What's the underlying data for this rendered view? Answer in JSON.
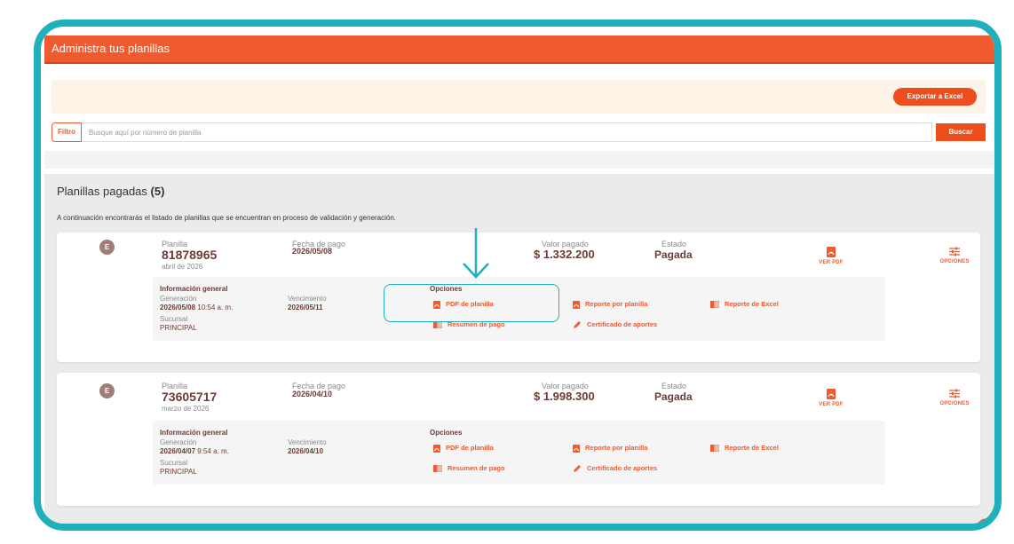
{
  "header": {
    "title": "Administra tus planillas"
  },
  "toolbar": {
    "export_label": "Exportar a Excel"
  },
  "search": {
    "filter_label": "Filtro",
    "placeholder": "Busque aquí por número de planilla",
    "button_label": "Buscar"
  },
  "list": {
    "title": "Planillas pagadas",
    "count": "(5)",
    "description": "A continuación encontrarás el listado de planillas que se encuentran en proceso de validación y generación."
  },
  "labels": {
    "planilla": "Planilla",
    "fecha_pago": "Fecha de pago",
    "valor_pagado": "Valor pagado",
    "estado": "Estado",
    "ver_pdf": "VER PDF",
    "opciones": "OPCIONES",
    "info_general": "Información general",
    "generacion": "Generación",
    "vencimiento": "Vencimiento",
    "sucursal": "Sucursal",
    "opciones_title": "Opciones"
  },
  "options": {
    "pdf": "PDF de planilla",
    "reporte_planilla": "Reporte por planilla",
    "reporte_excel": "Reporte de Excel",
    "resumen": "Resumen de pago",
    "certificado": "Certificado de aportes"
  },
  "cards": [
    {
      "avatar": "E",
      "number": "81878965",
      "period": "abril de 2026",
      "payment_date": "2026/05/08",
      "amount": "$ 1.332.200",
      "status": "Pagada",
      "generation_date": "2026/05/08",
      "generation_time": " 10:54 a. m.",
      "due_date": "2026/05/11",
      "branch": "PRINCIPAL"
    },
    {
      "avatar": "E",
      "number": "73605717",
      "period": "marzo de 2026",
      "payment_date": "2026/04/10",
      "amount": "$ 1.998.300",
      "status": "Pagada",
      "generation_date": "2026/04/07",
      "generation_time": " 9:54 a. m.",
      "due_date": "2026/04/10",
      "branch": "PRINCIPAL"
    }
  ],
  "colors": {
    "accent": "#ef5a2e",
    "highlight": "#1fb0bb",
    "text_dark": "#6d3b35"
  },
  "icons": [
    "pdf-icon",
    "sliders-icon",
    "excel-icon",
    "pencil-icon",
    "arrow-down-icon"
  ]
}
